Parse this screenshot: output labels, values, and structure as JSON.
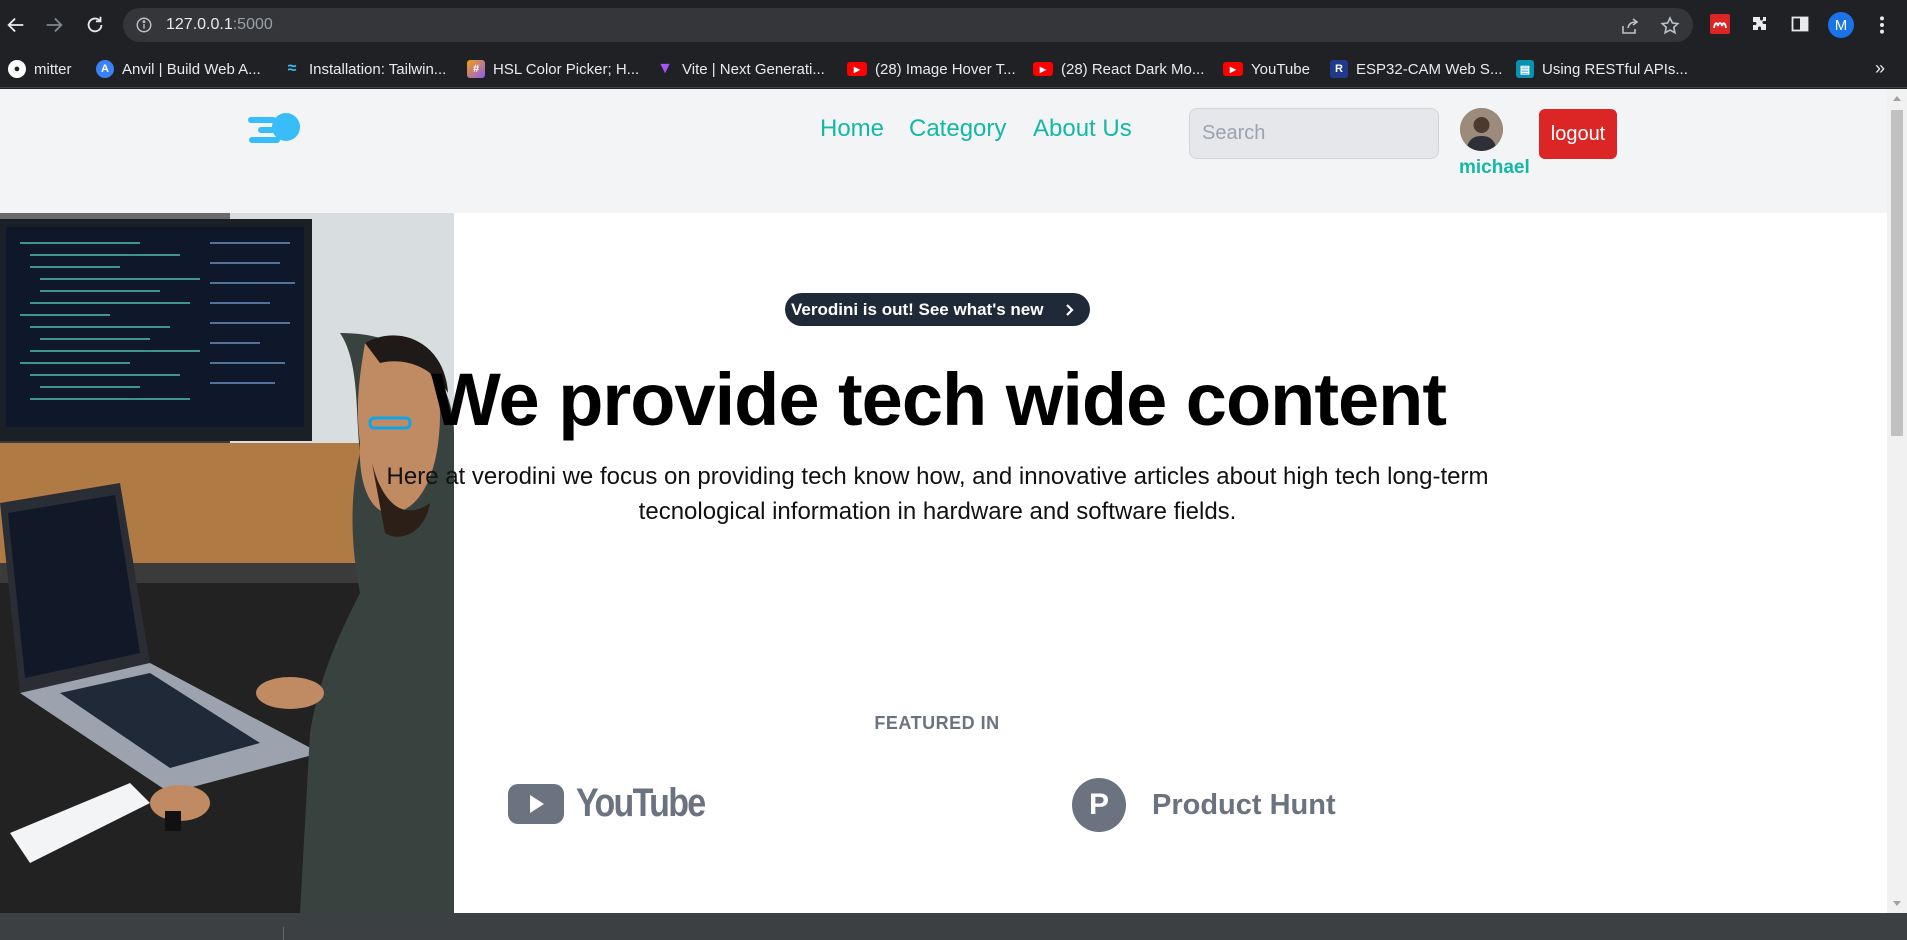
{
  "browser": {
    "url_host": "127.0.0.1",
    "url_port": ":5000",
    "profile_initial": "M",
    "bookmarks": [
      {
        "label": "mitter",
        "color": "#ffffff"
      },
      {
        "label": "Anvil | Build Web A...",
        "color": "#3b82f6"
      },
      {
        "label": "Installation: Tailwin...",
        "color": "#38bdf8"
      },
      {
        "label": "HSL Color Picker; H...",
        "color": "#f59e0b"
      },
      {
        "label": "Vite | Next Generati...",
        "color": "#a855f7"
      },
      {
        "label": "(28) Image Hover T...",
        "color": "#ff0000"
      },
      {
        "label": "(28) React Dark Mo...",
        "color": "#ff0000"
      },
      {
        "label": "YouTube",
        "color": "#ff0000"
      },
      {
        "label": "ESP32-CAM Web S...",
        "color": "#1e3a8a"
      },
      {
        "label": "Using RESTful APIs...",
        "color": "#0891b2"
      }
    ],
    "more_bookmarks": "»"
  },
  "nav": {
    "links": [
      "Home",
      "Category",
      "About Us"
    ],
    "search_placeholder": "Search",
    "username": "michael",
    "logout_label": "logout"
  },
  "hero": {
    "pill_text": "Verodini is out! See what's new",
    "title": "We provide tech wide content",
    "subtitle": "Here at verodini we focus on providing tech know how, and innovative articles about high tech long-term tecnological information in hardware and software fields."
  },
  "featured": {
    "heading": "FEATURED IN",
    "youtube": "YouTube",
    "producthunt_letter": "P",
    "producthunt": "Product Hunt"
  },
  "colors": {
    "accent": "#14b8a6",
    "logout": "#dc2626",
    "logo": "#38bdf8"
  }
}
